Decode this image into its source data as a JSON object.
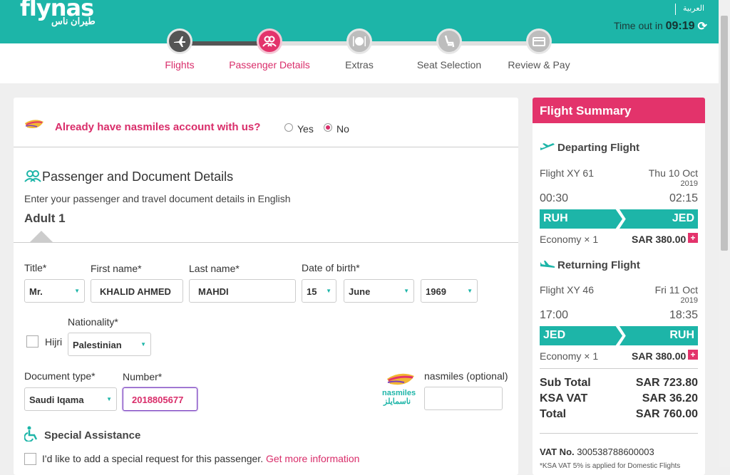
{
  "header": {
    "logo": "flynas",
    "logo_ar": "طيران ناس",
    "language": "العربية",
    "timeout_label": "Time out in",
    "timeout_value": "09:19"
  },
  "steps": [
    {
      "label": "Flights",
      "icon": "plane-icon"
    },
    {
      "label": "Passenger Details",
      "icon": "passengers-icon"
    },
    {
      "label": "Extras",
      "icon": "meal-icon"
    },
    {
      "label": "Seat Selection",
      "icon": "seat-icon"
    },
    {
      "label": "Review & Pay",
      "icon": "payment-icon"
    }
  ],
  "nasmiles": {
    "question": "Already have nasmiles account with us?",
    "yes": "Yes",
    "no": "No",
    "selected": "No"
  },
  "section": {
    "title": "Passenger and Document Details",
    "subtitle": "Enter your passenger and travel document details in English",
    "adult": "Adult 1"
  },
  "form": {
    "title_label": "Title*",
    "title_value": "Mr.",
    "first_label": "First name*",
    "first_value": "KHALID AHMED",
    "last_label": "Last name*",
    "last_value": "MAHDI",
    "dob_label": "Date of birth*",
    "dob_day": "15",
    "dob_month": "June",
    "dob_year": "1969",
    "hijri_label": "Hijri",
    "nationality_label": "Nationality*",
    "nationality_value": "Palestinian",
    "doctype_label": "Document type*",
    "doctype_value": "Saudi Iqama",
    "number_label": "Number*",
    "number_value": "2018805677",
    "nasmiles_label": "nasmiles (optional)",
    "nasmiles_logo": "nasmiles",
    "nasmiles_logo_ar": "ناسمايلز"
  },
  "special": {
    "title": "Special Assistance",
    "text": "I'd like to add a special request for this passenger.",
    "link": "Get more information"
  },
  "summary": {
    "title": "Flight Summary",
    "departing": {
      "heading": "Departing Flight",
      "flight": "Flight XY 61",
      "date": "Thu 10 Oct",
      "year": "2019",
      "dep_time": "00:30",
      "arr_time": "02:15",
      "from": "RUH",
      "to": "JED",
      "class": "Economy × 1",
      "price": "SAR 380.00"
    },
    "returning": {
      "heading": "Returning Flight",
      "flight": "Flight XY 46",
      "date": "Fri 11 Oct",
      "year": "2019",
      "dep_time": "17:00",
      "arr_time": "18:35",
      "from": "JED",
      "to": "RUH",
      "class": "Economy × 1",
      "price": "SAR 380.00"
    },
    "subtotal_label": "Sub Total",
    "subtotal": "SAR 723.80",
    "vat_label": "KSA VAT",
    "vat": "SAR 36.20",
    "total_label": "Total",
    "total": "SAR 760.00",
    "vat_no_label": "VAT No.",
    "vat_no": "300538788600003",
    "vat_note": "*KSA VAT 5% is applied for Domestic Flights"
  },
  "colors": {
    "teal": "#1db5a8",
    "pink": "#e3336b"
  }
}
